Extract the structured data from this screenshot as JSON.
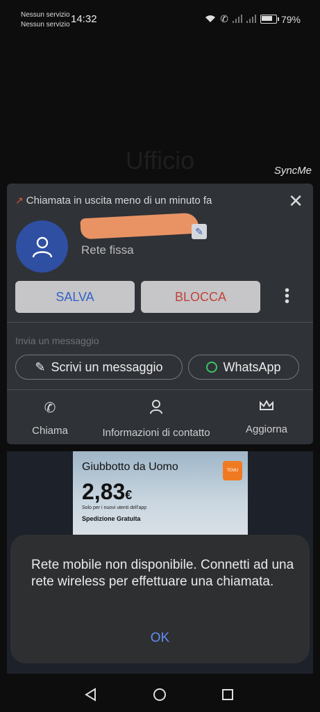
{
  "status_bar": {
    "carrier1": "Nessun servizio",
    "carrier2": "Nessun servizio",
    "time": "14:32",
    "battery": "79%",
    "icons": [
      "wifi-icon",
      "wifi-call-icon",
      "signal-icon",
      "signal-icon",
      "battery-icon"
    ]
  },
  "background": {
    "title": "Ufficio",
    "brand": "SyncMe"
  },
  "card": {
    "call_info": "Chiamata in uscita meno di un minuto fa",
    "contact_subtitle": "Rete fissa",
    "save_label": "SALVA",
    "block_label": "BLOCCA",
    "message_hint": "Invia un messaggio",
    "write_label": "Scrivi un messaggio",
    "whatsapp_label": "WhatsApp",
    "actions": {
      "call": "Chiama",
      "info": "Informazioni di contatto",
      "update": "Aggiorna"
    }
  },
  "ad": {
    "title": "Giubbotto da Uomo",
    "price": "2,83",
    "currency": "€",
    "small": "Solo per i nuovi utenti dell'app",
    "shipping": "Spedizione Gratuita",
    "badge": "TEMU"
  },
  "dialog": {
    "message": "Rete mobile non disponibile. Connetti ad una rete wireless per effettuare una chiamata.",
    "ok_label": "OK"
  },
  "colors": {
    "accent_blue": "#3461c6",
    "block_red": "#c1413a",
    "whatsapp_green": "#3cc464",
    "ok_blue": "#5f8df2"
  }
}
